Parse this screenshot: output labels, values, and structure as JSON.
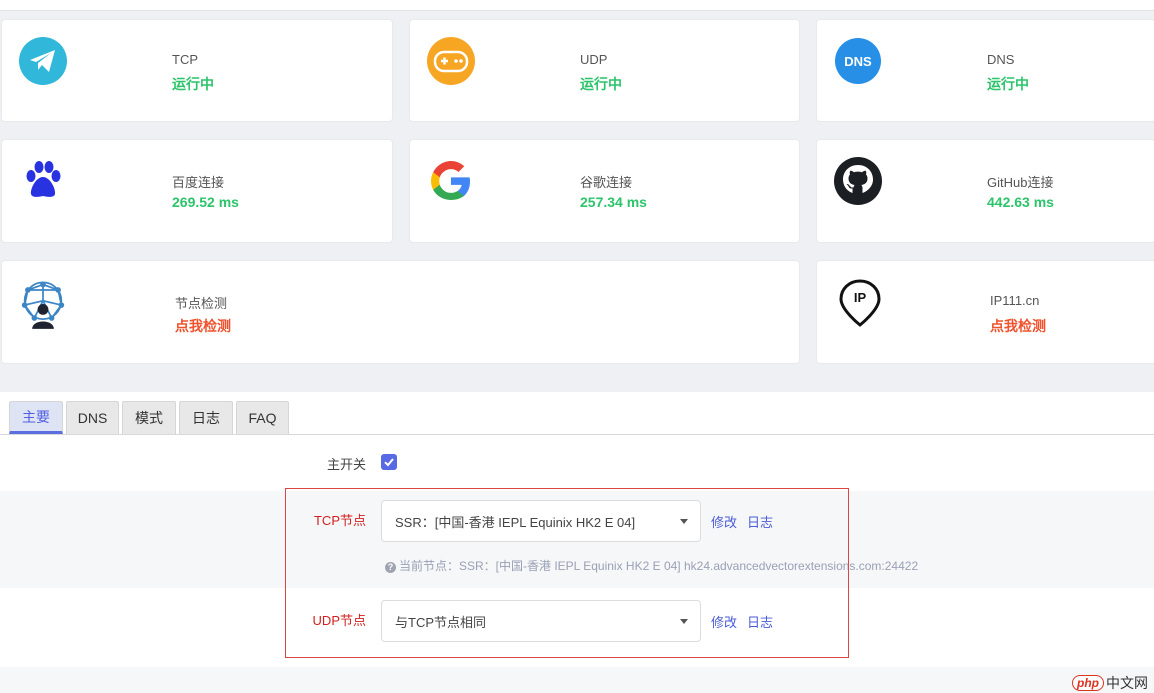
{
  "status_cards": {
    "tcp": {
      "label": "TCP",
      "value": "运行中"
    },
    "udp": {
      "label": "UDP",
      "value": "运行中"
    },
    "dns": {
      "label": "DNS",
      "value": "运行中",
      "icon_text": "DNS"
    },
    "baidu": {
      "label": "百度连接",
      "value": "269.52 ms"
    },
    "google": {
      "label": "谷歌连接",
      "value": "257.34 ms"
    },
    "github": {
      "label": "GitHub连接",
      "value": "442.63 ms"
    },
    "node_check": {
      "label": "节点检测",
      "value": "点我检测"
    },
    "ip111": {
      "label": "IP111.cn",
      "value": "点我检测",
      "icon_text": "IP"
    }
  },
  "tabs": [
    "主要",
    "DNS",
    "模式",
    "日志",
    "FAQ"
  ],
  "form": {
    "main_switch_label": "主开关",
    "main_switch_checked": true,
    "tcp_node": {
      "label": "TCP节点",
      "selected": "SSR：[中国-香港 IEPL Equinix HK2 E 04]",
      "edit": "修改",
      "log": "日志",
      "hint": "当前节点：SSR：[中国-香港 IEPL Equinix HK2 E 04] hk24.advancedvectorextensions.com:24422"
    },
    "udp_node": {
      "label": "UDP节点",
      "selected": "与TCP节点相同",
      "edit": "修改",
      "log": "日志"
    }
  },
  "watermark": {
    "badge": "php",
    "text": "中文网"
  },
  "colors": {
    "ok_green": "#2cc46b",
    "action_red": "#f0522d",
    "accent_blue": "#5869e4",
    "label_red": "#d21f1f"
  }
}
